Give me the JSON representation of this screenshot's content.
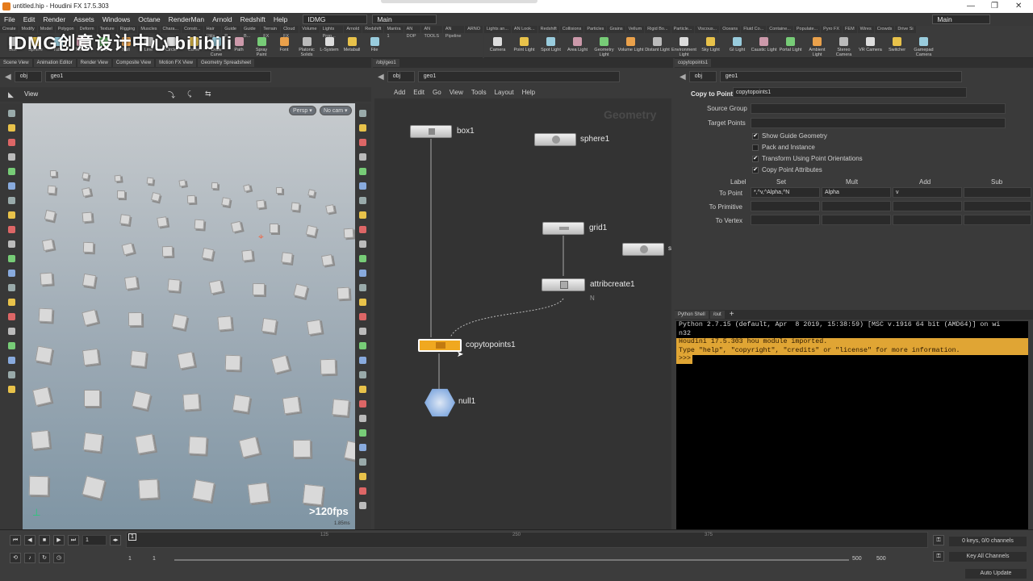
{
  "window": {
    "title": "untitled.hip - Houdini FX 17.5.303",
    "min": "—",
    "max": "❐",
    "close": "✕"
  },
  "menu": [
    "File",
    "Edit",
    "Render",
    "Assets",
    "Windows",
    "Octane",
    "RenderMan",
    "Arnold",
    "Redshift",
    "Help"
  ],
  "desktop_combo": "IDMG",
  "main_combo": "Main",
  "main_combo_right": "Main",
  "watermark": "IDMG创意设计中心 bilibili",
  "shelf_left": {
    "tabs": [
      "Create",
      "Modify",
      "Model",
      "Polygon",
      "Deform",
      "Texture",
      "Rigging",
      "Muscles",
      "Chara...",
      "Constr...",
      "Hair Utils",
      "Guide P...",
      "Guide B...",
      "Terrain FX",
      "Cloud FX",
      "Volume",
      "Lights Prop...",
      "Arnold",
      "Redshift",
      "Mantra 1",
      "AN DOP",
      "AN TOOLS",
      "AN Pipeline",
      "ARNO"
    ],
    "tools": [
      "Box",
      "Sphere",
      "Tube",
      "Torus",
      "Grid",
      "Null",
      "Line",
      "Circle",
      "Curve",
      "Draw Curve",
      "Path",
      "Spray Paint",
      "Font",
      "Platonic Solids",
      "L-System",
      "Metaball",
      "File"
    ]
  },
  "shelf_right": {
    "tabs": [
      "Lights an...",
      "AN Look...",
      "Redshift",
      "Collisions",
      "Particles",
      "Grains",
      "Vellum",
      "Rigid Bo...",
      "Particle...",
      "Viscous...",
      "Oceans",
      "Fluid Co...",
      "Containe...",
      "Populate...",
      "Pyro FX",
      "FEM",
      "Wires",
      "Crowds",
      "Drive Si"
    ],
    "tools": [
      "Camera",
      "Point Light",
      "Spot Light",
      "Area Light",
      "Geometry Light",
      "Volume Light",
      "Distant Light",
      "Environment Light",
      "Sky Light",
      "GI Light",
      "Caustic Light",
      "Portal Light",
      "Ambient Light",
      "Stereo Camera",
      "VR Camera",
      "Switcher",
      "Gamepad Camera"
    ]
  },
  "left_panel": {
    "tabs": [
      "Scene View",
      "Animation Editor",
      "Render View",
      "Composite View",
      "Motion FX View",
      "Geometry Spreadsheet"
    ],
    "path": [
      "obj",
      "geo1"
    ],
    "view_label": "View",
    "persp": "Persp ▾",
    "cam": "No cam ▾",
    "fps": ">120fps",
    "ms": "1.85ms"
  },
  "network": {
    "tab": "/obj/geo1",
    "path": [
      "obj",
      "geo1"
    ],
    "menu": [
      "Add",
      "Edit",
      "Go",
      "View",
      "Tools",
      "Layout",
      "Help"
    ],
    "watermark": "Geometry",
    "nodes": {
      "box": "box1",
      "sphere": "sphere1",
      "grid": "grid1",
      "attrib": "attribcreate1",
      "attrib_flag": "N",
      "copy": "copytopoints1",
      "null": "null1",
      "partial": "s"
    }
  },
  "params": {
    "tab": "copytopoints1",
    "path": [
      "obj",
      "geo1"
    ],
    "type": "Copy to Points",
    "name": "copytopoints1",
    "source_group": "Source Group",
    "target_points": "Target Points",
    "checks": [
      {
        "label": "Show Guide Geometry",
        "checked": true
      },
      {
        "label": "Pack and Instance",
        "checked": false
      },
      {
        "label": "Transform Using Point Orientations",
        "checked": true
      },
      {
        "label": "Copy Point Attributes",
        "checked": true
      }
    ],
    "cols": [
      "Label",
      "Set",
      "Mult",
      "Add",
      "Sub"
    ],
    "rows": [
      {
        "label": "To Point",
        "set": "*,^v,^Alpha,^N",
        "mult": "Alpha",
        "add": "v"
      },
      {
        "label": "To Primitive",
        "set": "",
        "mult": "",
        "add": ""
      },
      {
        "label": "To Vertex",
        "set": "",
        "mult": "",
        "add": ""
      }
    ]
  },
  "console": {
    "tabs": [
      "Python Shell",
      "/out"
    ],
    "lines": [
      "Python 2.7.15 (default, Apr  8 2019, 15:38:59) [MSC v.1916 64 bit (AMD64)] on wi",
      "n32"
    ],
    "hl_lines": [
      "Houdini 17.5.303 hou module imported.",
      "Type \"help\", \"copyright\", \"credits\" or \"license\" for more information.",
      ">>> "
    ]
  },
  "timeline": {
    "frame": "1",
    "start": "1",
    "start2": "1",
    "end": "500",
    "end2": "500",
    "ticks": [
      "125",
      "250",
      "375"
    ],
    "marker": "1",
    "keys": "0 keys, 0/0 channels",
    "key_all": "Key All Channels",
    "auto": "Auto Update"
  },
  "colors": {
    "accent": "#e0a534",
    "node_selected": "#f0a820",
    "null_node": "#5b8fd6"
  }
}
